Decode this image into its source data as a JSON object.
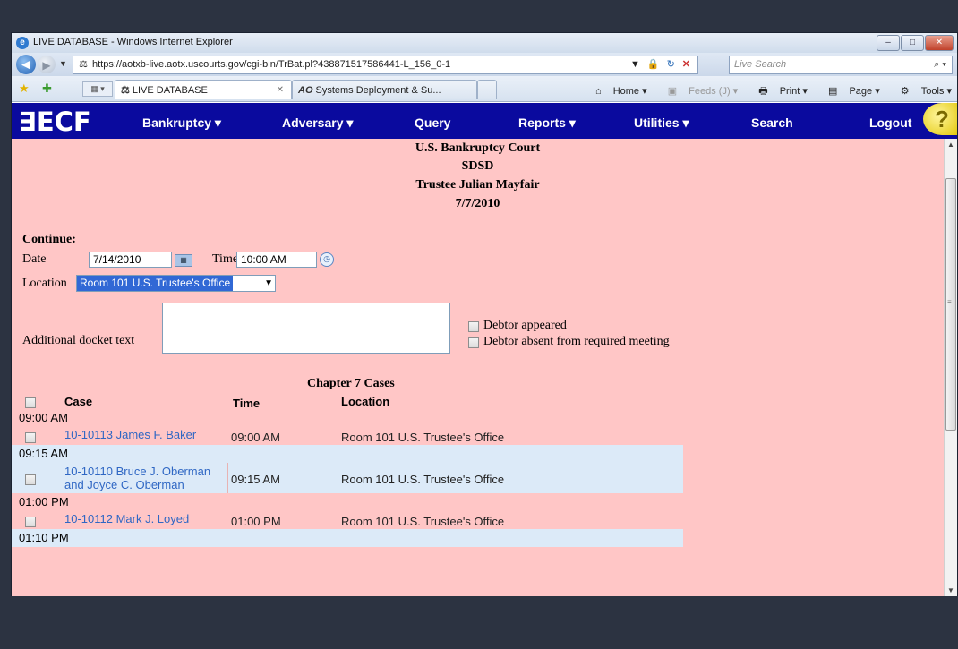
{
  "window": {
    "title": "LIVE DATABASE - Windows Internet Explorer",
    "url": "https://aotxb-live.aotx.uscourts.gov/cgi-bin/TrBat.pl?438871517586441-L_156_0-1",
    "search_placeholder": "Live Search",
    "tabs": [
      {
        "label": "LIVE DATABASE",
        "active": true
      },
      {
        "label": "Systems Deployment & Su...",
        "active": false
      }
    ],
    "command_bar": {
      "home": "Home",
      "feeds": "Feeds (J)",
      "print": "Print",
      "page": "Page",
      "tools": "Tools"
    }
  },
  "nav": {
    "logo": "ECF",
    "items": [
      "Bankruptcy",
      "Adversary",
      "Query",
      "Reports",
      "Utilities",
      "Search",
      "Logout"
    ],
    "help": "?"
  },
  "header": {
    "court": "U.S. Bankruptcy Court",
    "district": "SDSD",
    "trustee": "Trustee Julian Mayfair",
    "date": "7/7/2010"
  },
  "form": {
    "continue_label": "Continue:",
    "date_label": "Date",
    "date_value": "7/14/2010",
    "time_label": "Time",
    "time_value": "10:00 AM",
    "location_label": "Location",
    "location_value": "Room 101 U.S. Trustee's Office",
    "docket_label": "Additional docket text",
    "docket_value": "",
    "checkbox_appeared": "Debtor appeared",
    "checkbox_absent": "Debtor absent from required meeting"
  },
  "cases": {
    "section_title": "Chapter 7 Cases",
    "columns": {
      "case": "Case",
      "time": "Time",
      "location": "Location"
    },
    "groups": [
      {
        "time": "09:00 AM",
        "case": "10-10113 James F. Baker",
        "case_line2": "",
        "case_time": "09:00 AM",
        "location": "Room 101 U.S. Trustee's Office"
      },
      {
        "time": "09:15 AM",
        "case": "10-10110 Bruce J. Oberman",
        "case_line2": "and Joyce C. Oberman",
        "case_time": "09:15 AM",
        "location": "Room 101 U.S. Trustee's Office"
      },
      {
        "time": "01:00 PM",
        "case": "10-10112 Mark J. Loyed",
        "case_line2": "",
        "case_time": "01:00 PM",
        "location": "Room 101 U.S. Trustee's Office"
      },
      {
        "time": "01:10 PM"
      }
    ]
  }
}
